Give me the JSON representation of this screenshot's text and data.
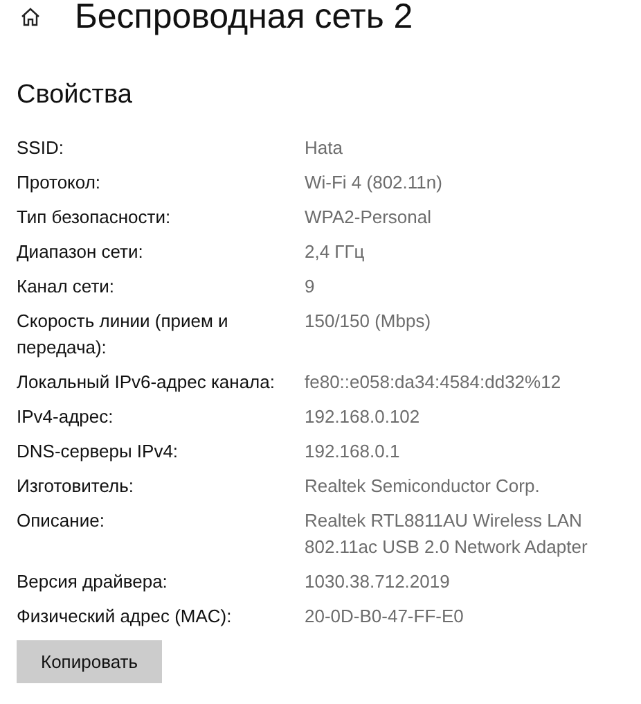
{
  "page": {
    "title": "Беспроводная сеть 2"
  },
  "section": {
    "title": "Свойства"
  },
  "properties": [
    {
      "label": "SSID:",
      "value": "Hata"
    },
    {
      "label": "Протокол:",
      "value": "Wi-Fi 4 (802.11n)"
    },
    {
      "label": "Тип безопасности:",
      "value": "WPA2-Personal"
    },
    {
      "label": "Диапазон сети:",
      "value": "2,4 ГГц"
    },
    {
      "label": "Канал сети:",
      "value": "9"
    },
    {
      "label": "Скорость линии (прием и передача):",
      "value": "150/150 (Mbps)"
    },
    {
      "label": "Локальный IPv6-адрес канала:",
      "value": "fe80::e058:da34:4584:dd32%12"
    },
    {
      "label": "IPv4-адрес:",
      "value": "192.168.0.102"
    },
    {
      "label": "DNS-серверы IPv4:",
      "value": "192.168.0.1"
    },
    {
      "label": "Изготовитель:",
      "value": "Realtek Semiconductor Corp."
    },
    {
      "label": "Описание:",
      "value": "Realtek RTL8811AU Wireless LAN 802.11ac USB 2.0 Network Adapter"
    },
    {
      "label": "Версия драйвера:",
      "value": "1030.38.712.2019"
    },
    {
      "label": "Физический адрес (MAC):",
      "value": "20-0D-B0-47-FF-E0"
    }
  ],
  "buttons": [
    {
      "label": "Копировать"
    }
  ]
}
